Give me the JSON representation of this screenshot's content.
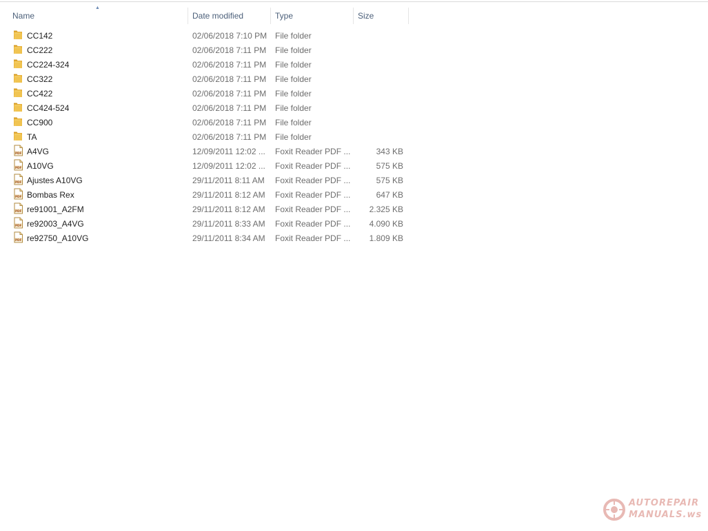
{
  "columns": {
    "name": "Name",
    "date": "Date modified",
    "type": "Type",
    "size": "Size"
  },
  "sort": {
    "column": "name",
    "direction": "ascending"
  },
  "items": [
    {
      "kind": "folder",
      "icon": "folder-icon",
      "name": "CC142",
      "date": "02/06/2018 7:10 PM",
      "type": "File folder",
      "size": ""
    },
    {
      "kind": "folder",
      "icon": "folder-icon",
      "name": "CC222",
      "date": "02/06/2018 7:11 PM",
      "type": "File folder",
      "size": ""
    },
    {
      "kind": "folder",
      "icon": "folder-icon",
      "name": "CC224-324",
      "date": "02/06/2018 7:11 PM",
      "type": "File folder",
      "size": ""
    },
    {
      "kind": "folder",
      "icon": "folder-icon",
      "name": "CC322",
      "date": "02/06/2018 7:11 PM",
      "type": "File folder",
      "size": ""
    },
    {
      "kind": "folder",
      "icon": "folder-icon",
      "name": "CC422",
      "date": "02/06/2018 7:11 PM",
      "type": "File folder",
      "size": ""
    },
    {
      "kind": "folder",
      "icon": "folder-icon",
      "name": "CC424-524",
      "date": "02/06/2018 7:11 PM",
      "type": "File folder",
      "size": ""
    },
    {
      "kind": "folder",
      "icon": "folder-icon",
      "name": "CC900",
      "date": "02/06/2018 7:11 PM",
      "type": "File folder",
      "size": ""
    },
    {
      "kind": "folder",
      "icon": "folder-icon",
      "name": "TA",
      "date": "02/06/2018 7:11 PM",
      "type": "File folder",
      "size": ""
    },
    {
      "kind": "pdf",
      "icon": "pdf-file-icon",
      "name": "A4VG",
      "date": "12/09/2011 12:02 ...",
      "type": "Foxit Reader PDF ...",
      "size": "343 KB"
    },
    {
      "kind": "pdf",
      "icon": "pdf-file-icon",
      "name": "A10VG",
      "date": "12/09/2011 12:02 ...",
      "type": "Foxit Reader PDF ...",
      "size": "575 KB"
    },
    {
      "kind": "pdf",
      "icon": "pdf-file-icon",
      "name": "Ajustes A10VG",
      "date": "29/11/2011 8:11 AM",
      "type": "Foxit Reader PDF ...",
      "size": "575 KB"
    },
    {
      "kind": "pdf",
      "icon": "pdf-file-icon",
      "name": "Bombas Rex",
      "date": "29/11/2011 8:12 AM",
      "type": "Foxit Reader PDF ...",
      "size": "647 KB"
    },
    {
      "kind": "pdf",
      "icon": "pdf-file-icon",
      "name": "re91001_A2FM",
      "date": "29/11/2011 8:12 AM",
      "type": "Foxit Reader PDF ...",
      "size": "2.325 KB"
    },
    {
      "kind": "pdf",
      "icon": "pdf-file-icon",
      "name": "re92003_A4VG",
      "date": "29/11/2011 8:33 AM",
      "type": "Foxit Reader PDF ...",
      "size": "4.090 KB"
    },
    {
      "kind": "pdf",
      "icon": "pdf-file-icon",
      "name": "re92750_A10VG",
      "date": "29/11/2011 8:34 AM",
      "type": "Foxit Reader PDF ...",
      "size": "1.809 KB"
    }
  ],
  "watermark": {
    "line1": "AUTOREPAIR",
    "line2": "MANUALS.ws"
  },
  "colors": {
    "header_text": "#4c607a",
    "folder": "#e8b23c",
    "pdf_accent": "#d9a441",
    "watermark": "#c0392b"
  }
}
